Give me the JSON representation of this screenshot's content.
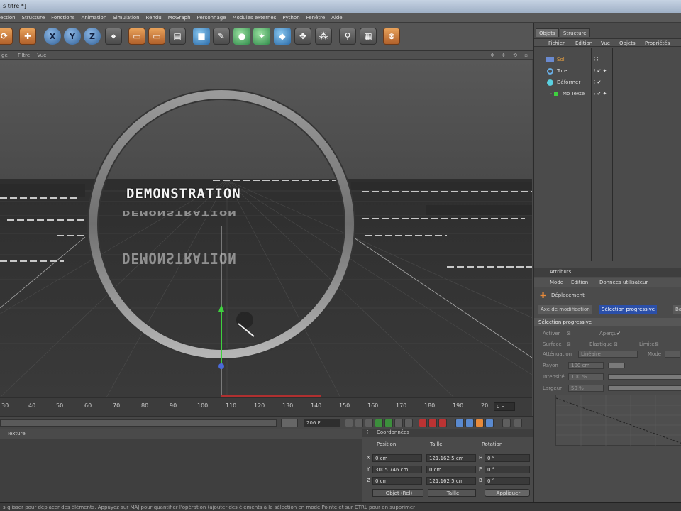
{
  "window": {
    "title": "s titre *]"
  },
  "menu": [
    "ection",
    "Structure",
    "Fonctions",
    "Animation",
    "Simulation",
    "Rendu",
    "MoGraph",
    "Personnage",
    "Modules externes",
    "Python",
    "Fenêtre",
    "Aide"
  ],
  "toolbar": {
    "axis_x": "X",
    "axis_y": "Y",
    "axis_z": "Z"
  },
  "viewport": {
    "header_items": [
      "ge",
      "Filtre",
      "Vue"
    ],
    "headline": "DEMONSTRATION",
    "headline_ghost": "DEMONSTRATION"
  },
  "timeline": {
    "ticks": [
      "30",
      "40",
      "50",
      "60",
      "70",
      "80",
      "90",
      "100",
      "110",
      "120",
      "130",
      "140",
      "150",
      "160",
      "170",
      "180",
      "190",
      "20"
    ],
    "frame_field": "0 F"
  },
  "transport": {
    "end_frame": "206 F"
  },
  "material": {
    "menu_item": "Texture"
  },
  "coords": {
    "title": "Coordonnées",
    "col_position": "Position",
    "col_size": "Taille",
    "col_rotation": "Rotation",
    "rows": [
      {
        "axis": "X",
        "pos": "0 cm",
        "size": "121.162 5 cm",
        "rot_axis": "H",
        "rot": "0 °"
      },
      {
        "axis": "Y",
        "pos": "3005.746 cm",
        "size": "0 cm",
        "rot_axis": "P",
        "rot": "0 °"
      },
      {
        "axis": "Z",
        "pos": "0 cm",
        "size": "121.162 5 cm",
        "rot_axis": "B",
        "rot": "0 °"
      }
    ],
    "mode_select": "Objet (Rel)",
    "size_select": "Taille",
    "apply_button": "Appliquer"
  },
  "statusbar": {
    "text": "s-glisser pour déplacer des éléments. Appuyez sur MAJ pour quantifier l'opération (ajouter des éléments à la sélection en mode Pointe et sur CTRL pour en supprimer"
  },
  "objects_panel": {
    "tabs": [
      "Objets",
      "Structure"
    ],
    "menu": [
      "Fichier",
      "Edition",
      "Vue",
      "Objets",
      "Propriétés"
    ],
    "items": [
      {
        "name": "Sol"
      },
      {
        "name": "Tore"
      },
      {
        "name": "Déformer"
      },
      {
        "name": "Mo Texte"
      }
    ]
  },
  "attributes_panel": {
    "title": "Attributs",
    "menu": [
      "Mode",
      "Edition",
      "Données utilisateur"
    ],
    "object_name": "Déplacement",
    "tabs": [
      "Axe de modification",
      "Sélection progressive",
      "Ba"
    ],
    "section": "Sélection progressive",
    "fields": {
      "activer": "Activer",
      "apercu": "Aperçu",
      "surface": "Surface",
      "elastique": "Elastique",
      "limiter": "Limiter",
      "attenuation": "Atténuation",
      "attenuation_value": "Linéaire",
      "mode": "Mode",
      "rayon": "Rayon",
      "rayon_value": "100 cm",
      "intensite": "Intensité",
      "intensite_value": "100 %",
      "largeur": "Largeur",
      "largeur_value": "50 %"
    }
  },
  "colors": {
    "accent_orange": "#e88a3a",
    "axis_green": "#3fd03f",
    "axis_blue": "#4a6ad8",
    "selected_tab": "#2b4fa8"
  }
}
